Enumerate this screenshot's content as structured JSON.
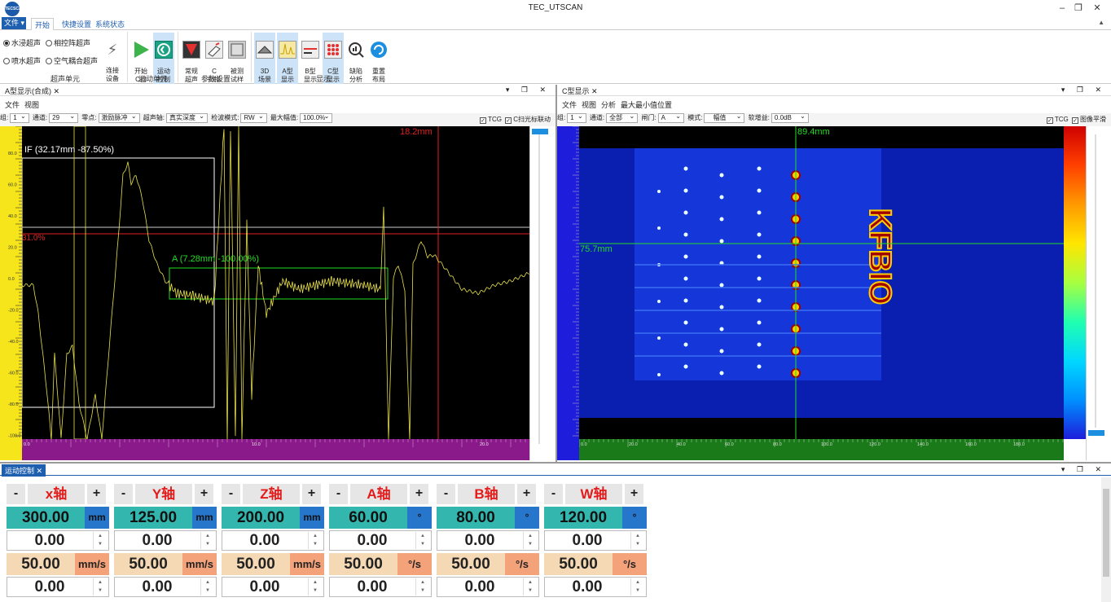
{
  "app": {
    "title": "TEC_UTSCAN",
    "logo_text": "TECSCAN"
  },
  "ribbon": {
    "file_tab": "文件",
    "tabs": [
      "开始",
      "快捷设置",
      "系统状态"
    ],
    "radios": [
      {
        "label": "水浸超声",
        "checked": true
      },
      {
        "label": "相控阵超声",
        "checked": false
      },
      {
        "label": "喷水超声",
        "checked": false
      },
      {
        "label": "空气耦合超声",
        "checked": false
      }
    ],
    "connect": "连接\n设备",
    "buttons": {
      "start_c_scan": "开始\nC扫",
      "motion_ctrl": "运动\n控制",
      "normal_ut": "常规\n超声",
      "c_scan": "C\n扫描",
      "test_sample": "被测\n试样",
      "scene_3d": "3D\n场景",
      "a_display": "A型\n显示",
      "b_display": "B型\n显示",
      "c_display": "C型\n显示",
      "defect": "缺陷\n分析",
      "reset_layout": "重置\n布局"
    },
    "groups": [
      "超声单元",
      "运动单元",
      "参数设置",
      "显示"
    ]
  },
  "a_panel": {
    "tab": "A型显示(合成)",
    "menu": [
      "文件",
      "视图"
    ],
    "toolbar": {
      "group_label": "组:",
      "group_val": "1",
      "channel_label": "通道:",
      "channel_val": "29",
      "zero_label": "零点:",
      "zero_val": "激励脉冲",
      "axis_label": "超声轴:",
      "axis_val": "真实深度",
      "detect_label": "检波模式:",
      "detect_val": "RW",
      "max_label": "最大幅值:",
      "max_val": "100.0%",
      "tcg": "TCG",
      "link": "C扫光标联动"
    },
    "overlays": {
      "if_label": "IF  (32.17mm  -87.50%)",
      "a_label": "A  (7.28mm  -100.00%)",
      "cursor_x": "18.2mm",
      "cursor_y": "31.0%"
    },
    "y_ticks": [
      "80.0",
      "60.0",
      "40.0",
      "20.0",
      "0.0",
      "-20.0",
      "-40.0",
      "-60.0",
      "-80.0",
      "-100.0"
    ],
    "x_ticks": [
      "0.0",
      "10.0",
      "20.0"
    ]
  },
  "c_panel": {
    "tab": "C型显示",
    "menu": [
      "文件",
      "视图",
      "分析",
      "最大最小值位置"
    ],
    "toolbar": {
      "group_label": "组:",
      "group_val": "1",
      "channel_label": "通道:",
      "channel_val": "全部",
      "gate_label": "闸门:",
      "gate_val": "A",
      "mode_label": "模式:",
      "mode_val": "幅值",
      "gain_label": "软增益:",
      "gain_val": "0.0dB",
      "tcg": "TCG",
      "smooth": "图像平滑"
    },
    "overlays": {
      "cursor_x": "89.4mm",
      "cursor_y": "75.7mm",
      "text": "KFBIO"
    },
    "x_ticks": [
      "0.0",
      "20.0",
      "40.0",
      "60.0",
      "80.0",
      "100.0",
      "120.0",
      "140.0",
      "160.0",
      "180.0"
    ]
  },
  "motion": {
    "tab": "运动控制",
    "axes": [
      {
        "name": "x轴",
        "pos": "300.00",
        "pos_unit": "mm",
        "target": "0.00",
        "speed": "50.00",
        "speed_unit": "mm/s",
        "step": "0.00"
      },
      {
        "name": "Y轴",
        "pos": "125.00",
        "pos_unit": "mm",
        "target": "0.00",
        "speed": "50.00",
        "speed_unit": "mm/s",
        "step": "0.00"
      },
      {
        "name": "Z轴",
        "pos": "200.00",
        "pos_unit": "mm",
        "target": "0.00",
        "speed": "50.00",
        "speed_unit": "mm/s",
        "step": "0.00"
      },
      {
        "name": "A轴",
        "pos": "60.00",
        "pos_unit": "°",
        "target": "0.00",
        "speed": "50.00",
        "speed_unit": "°/s",
        "step": "0.00"
      },
      {
        "name": "B轴",
        "pos": "80.00",
        "pos_unit": "°",
        "target": "0.00",
        "speed": "50.00",
        "speed_unit": "°/s",
        "step": "0.00"
      },
      {
        "name": "W轴",
        "pos": "120.00",
        "pos_unit": "°",
        "target": "0.00",
        "speed": "50.00",
        "speed_unit": "°/s",
        "step": "0.00"
      }
    ],
    "minus": "-",
    "plus": "+"
  },
  "colors": {
    "accent": "#1f5fb0",
    "teal": "#32b6ae",
    "unit_blue": "#2676cc",
    "speed_bg": "#f5d8b4",
    "speed_unit": "#f4a27a",
    "axis_red": "#e31b1b",
    "signal": "#e8e04a"
  }
}
